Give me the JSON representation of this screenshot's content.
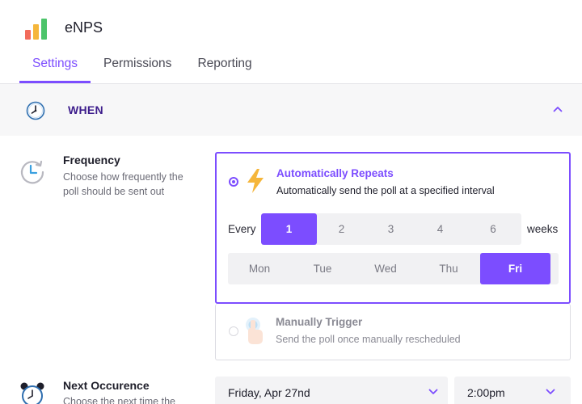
{
  "app": {
    "title": "eNPS",
    "logo_colors": [
      "#f26b5b",
      "#f5b63b",
      "#4cc46a"
    ]
  },
  "tabs": [
    {
      "label": "Settings",
      "active": true
    },
    {
      "label": "Permissions",
      "active": false
    },
    {
      "label": "Reporting",
      "active": false
    }
  ],
  "section": {
    "title": "WHEN",
    "icon": "clock-icon",
    "expanded": true
  },
  "frequency": {
    "label": "Frequency",
    "description": "Choose how frequently the poll should be sent out",
    "options": [
      {
        "title": "Automatically Repeats",
        "description": "Automatically send the poll at a specified interval",
        "icon": "lightning-icon",
        "selected": true
      },
      {
        "title": "Manually Trigger",
        "description": "Send the poll once manually rescheduled",
        "icon": "tap-hand-icon",
        "selected": false
      }
    ],
    "every_label": "Every",
    "interval_unit": "weeks",
    "intervals": [
      "1",
      "2",
      "3",
      "4",
      "6"
    ],
    "selected_interval": "1",
    "days": [
      "Mon",
      "Tue",
      "Wed",
      "Thu",
      "Fri"
    ],
    "selected_day": "Fri"
  },
  "next_occurrence": {
    "label": "Next Occurence",
    "description": "Choose the next time the",
    "date_value": "Friday, Apr 27nd",
    "time_value": "2:00pm"
  },
  "colors": {
    "accent": "#7c4dff",
    "section_title": "#3d1d8c",
    "lightning": "#f5b63b"
  }
}
